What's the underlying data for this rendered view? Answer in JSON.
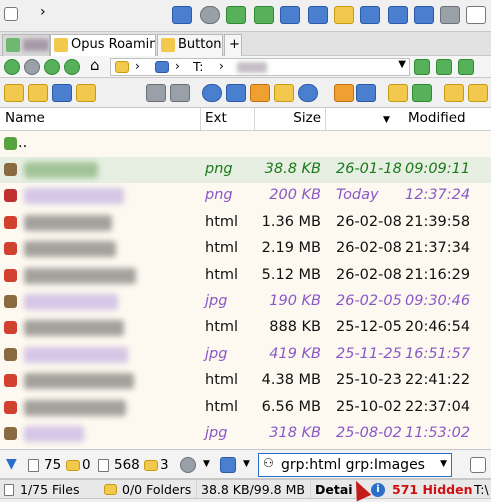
{
  "tabs": [
    {
      "label": ""
    },
    {
      "label": "Opus Roaming"
    },
    {
      "label": "Buttons"
    },
    {
      "label": "+"
    }
  ],
  "location": {
    "drive": "T:",
    "folder": ""
  },
  "columns": {
    "name": "Name",
    "ext": "Ext",
    "size": "Size",
    "modified": "Modified"
  },
  "parent_label": "..",
  "rows": [
    {
      "ext": "png",
      "size": "38.8 KB",
      "date": "26-01-18",
      "time": "09:09:11",
      "color": "#1a7a1a"
    },
    {
      "ext": "png",
      "size": "200 KB",
      "date": "Today",
      "time": "12:37:24",
      "color": "#8a58c8"
    },
    {
      "ext": "html",
      "size": "1.36 MB",
      "date": "26-02-08",
      "time": "21:39:58",
      "color": "#111111"
    },
    {
      "ext": "html",
      "size": "2.19 MB",
      "date": "26-02-08",
      "time": "21:37:34",
      "color": "#111111"
    },
    {
      "ext": "html",
      "size": "5.12 MB",
      "date": "26-02-08",
      "time": "21:16:29",
      "color": "#111111"
    },
    {
      "ext": "jpg",
      "size": "190 KB",
      "date": "26-02-05",
      "time": "09:30:46",
      "color": "#8a58c8"
    },
    {
      "ext": "html",
      "size": "888 KB",
      "date": "25-12-05",
      "time": "20:46:54",
      "color": "#111111"
    },
    {
      "ext": "jpg",
      "size": "419 KB",
      "date": "25-11-25",
      "time": "16:51:57",
      "color": "#8a58c8"
    },
    {
      "ext": "html",
      "size": "4.38 MB",
      "date": "25-10-23",
      "time": "22:41:22",
      "color": "#111111"
    },
    {
      "ext": "html",
      "size": "6.56 MB",
      "date": "25-10-02",
      "time": "22:37:04",
      "color": "#111111"
    },
    {
      "ext": "jpg",
      "size": "318 KB",
      "date": "25-08-02",
      "time": "11:53:02",
      "color": "#8a58c8"
    }
  ],
  "filter_bar": {
    "count_files": "75",
    "count_folders": "0",
    "count_total": "568",
    "count_other": "3",
    "filter_text": "grp:html grp:Images"
  },
  "status_bar": {
    "files": "1/75 Files",
    "folders": "0/0 Folders",
    "size": "38.8 KB/99.8 MB",
    "details": "Detai",
    "hidden": "571 Hidden",
    "drive": "T:\\"
  }
}
